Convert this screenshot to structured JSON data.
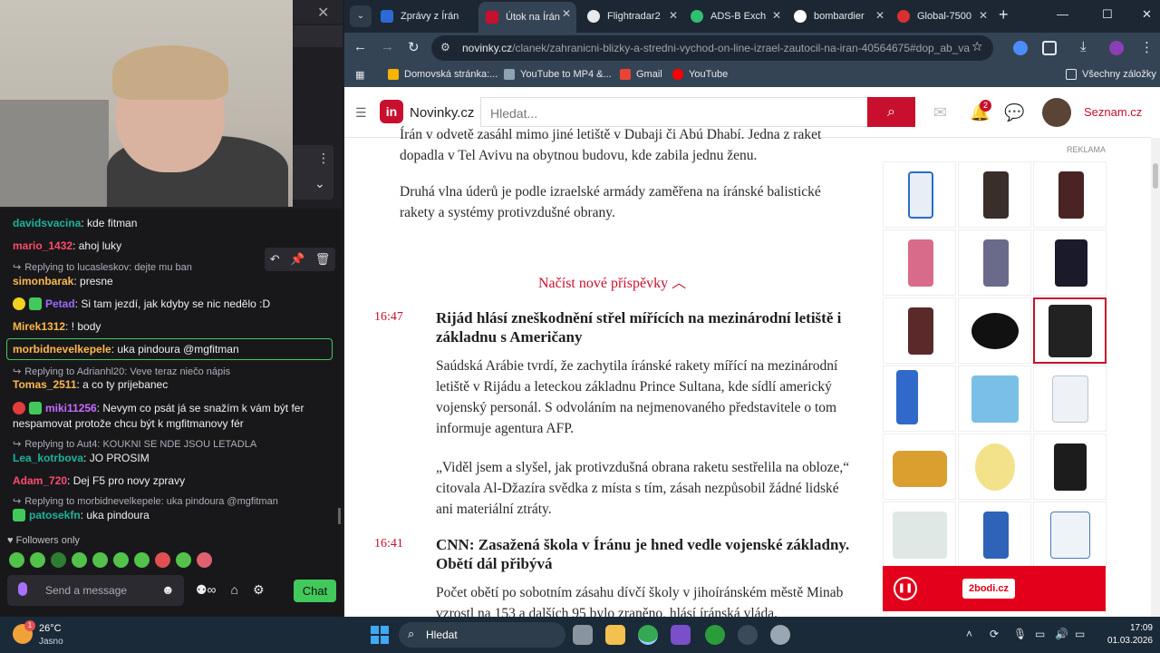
{
  "chat": {
    "messages": [
      {
        "user": "davidsvacina",
        "color": "#1bb49a",
        "text": "kde fitman"
      },
      {
        "user": "mario_1432",
        "color": "#ff4a6a",
        "text": "ahoj luky"
      },
      {
        "reply_to": "Replying to lucasleskov: dejte mu ban",
        "user": "simonbarak",
        "color": "#ffb84a",
        "text": "presne"
      },
      {
        "user": "Petad",
        "color": "#9b6bff",
        "text": "Si tam jezdí, jak kdyby se nic nedělo :D"
      },
      {
        "user": "Mirek1312",
        "color": "#ffb84a",
        "text": "! body"
      },
      {
        "user": "morbidnevelkepele",
        "color": "#ffb84a",
        "text": "uka pindoura @mgfitman"
      },
      {
        "reply_to": "Replying to Adrianhl20: Veve teraz niečo nápis",
        "user": "Tomas_2511",
        "color": "#ffb84a",
        "text": "a co ty prijebanec"
      },
      {
        "user": "miki11256",
        "color": "#c86bff",
        "text": "Nevym co psát já se snažím k vám být fer nespamovat protože chcu být k mgfitmanovy fér"
      },
      {
        "reply_to": "Replying to Aut4: KOUKNI SE NDE JSOU LETADLA",
        "user": "Lea_kotrbova",
        "color": "#1bb49a",
        "text": "JO PROSIM"
      },
      {
        "user": "Adam_720",
        "color": "#ff4a6a",
        "text": "Dej F5 pro novy zpravy"
      },
      {
        "reply_to": "Replying to morbidnevelkepele: uka pindoura @mgfitman",
        "user": "patosekfn",
        "color": "#1bb49a",
        "text": "uka pindoura"
      }
    ],
    "followers_only": "Followers only",
    "input_placeholder": "Send a message",
    "chat_button": "Chat"
  },
  "browser": {
    "tabs": [
      {
        "title": "Zprávy z Írán",
        "icon_color": "#2d6ad6"
      },
      {
        "title": "Útok na Írán",
        "icon_color": "#c8102e",
        "active": true
      },
      {
        "title": "Flightradar2",
        "icon_color": "#e6e9ed"
      },
      {
        "title": "ADS-B Exch",
        "icon_color": "#2fbf71"
      },
      {
        "title": "bombardier",
        "icon_color": "#ffffff"
      },
      {
        "title": "Global-7500",
        "icon_color": "#d93030"
      }
    ],
    "url_host": "novinky.cz",
    "url_path": "/clanek/zahranicni-blizky-a-stredni-vychod-on-line-izrael-zautocil-na-iran-40564675#dop_ab_va...",
    "bookmarks": [
      {
        "label": "Domovská stránka:...",
        "icon_color": "#f4b400"
      },
      {
        "label": "YouTube to MP4 &...",
        "icon_color": "#8fa3b5"
      },
      {
        "label": "Gmail",
        "icon_color": "#ea4335"
      },
      {
        "label": "YouTube",
        "icon_color": "#ff0000"
      }
    ],
    "all_bookmarks": "Všechny záložky"
  },
  "site": {
    "logo": "in",
    "name": "Novinky.cz",
    "search_placeholder": "Hledat...",
    "notif_count": "2",
    "seznam": "Seznam.cz",
    "ad_label": "REKLAMA",
    "ad_brand": "2bodi.cz"
  },
  "article": {
    "para1": "Írán v odvetě zasáhl mimo jiné letiště v Dubaji či Abú Dhabí. Jedna z raket dopadla v Tel Avivu na obytnou budovu, kde zabila jednu ženu.",
    "para2": "Druhá vlna úderů je podle izraelské armády zaměřena na íránské balistické rakety a systémy protivzdušné obrany.",
    "load_more": "Načíst nové příspěvky",
    "items": [
      {
        "time": "16:47",
        "headline": "Rijád hlásí zneškodnění střel mířících na mezinárodní letiště i základnu s Američany",
        "p1": "Saúdská Arábie tvrdí, že zachytila íránské rakety mířící na mezinárodní letiště v Rijádu a leteckou základnu Prince Sultana, kde sídlí americký vojenský personál. S odvoláním na nejmenovaného představitele o tom informuje agentura AFP.",
        "p2": "„Viděl jsem a slyšel, jak protivzdušná obrana raketu sestřelila na obloze,“ citovala Al-Džazíra svědka z místa s tím, zásah nezpůsobil žádné lidské ani materiální ztráty."
      },
      {
        "time": "16:41",
        "headline": "CNN: Zasažená škola v Íránu je hned vedle vojenské základny. Obětí dál přibývá",
        "p1": "Počet obětí po sobotním zásahu dívčí školy v jihoíránském městě Minab vzrostl na 153 a dalších 95 bylo zraněno, hlásí íránská vláda."
      }
    ]
  },
  "taskbar": {
    "temp": "26°C",
    "condition": "Jasno",
    "weather_badge": "1",
    "search": "Hledat",
    "time": "17:09",
    "date": "01.03.2026"
  }
}
